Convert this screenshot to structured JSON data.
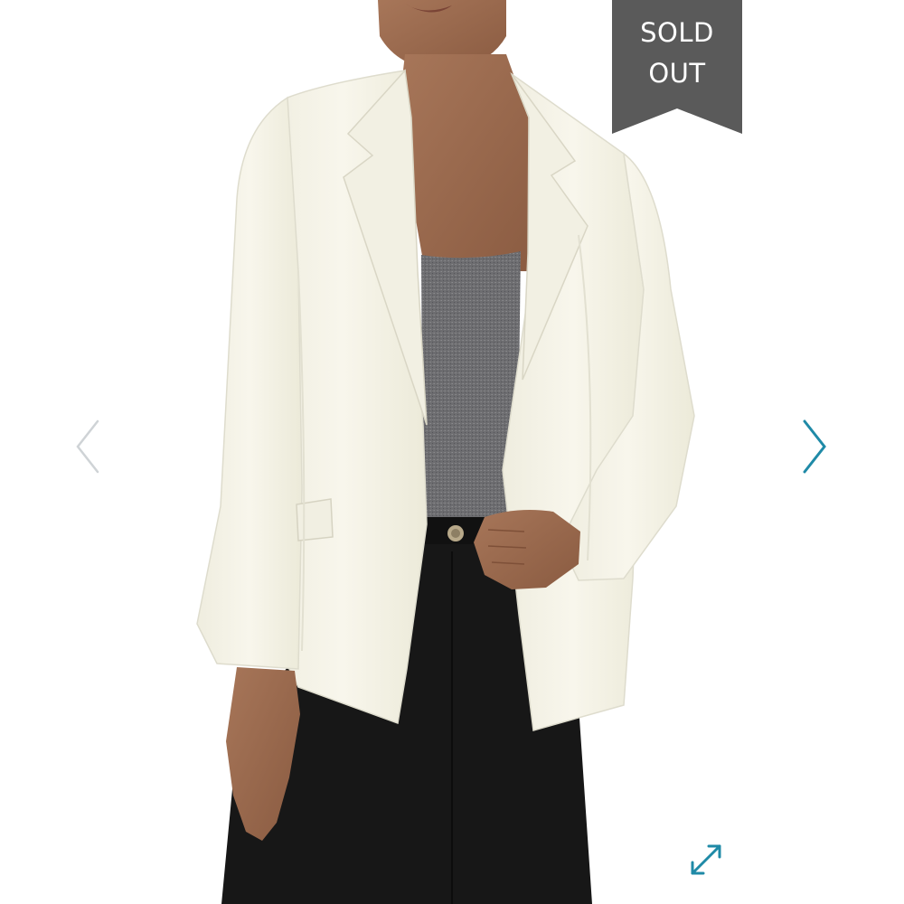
{
  "badge": {
    "line1": "SOLD",
    "line2": "OUT",
    "background": "#5a5a5a",
    "text_color": "#ffffff"
  },
  "navigation": {
    "prev_icon": "chevron-left-icon",
    "next_icon": "chevron-right-icon",
    "prev_color": "#cfd3d6",
    "next_color": "#1f8aa7"
  },
  "expand": {
    "icon": "expand-arrows-icon",
    "color": "#1f8aa7"
  },
  "photo": {
    "subject": "product-photo",
    "jacket_color": "#f6f4ea",
    "top_color": "#6a6a6c",
    "pants_color": "#161616",
    "skin_color": "#9a6a4e"
  }
}
